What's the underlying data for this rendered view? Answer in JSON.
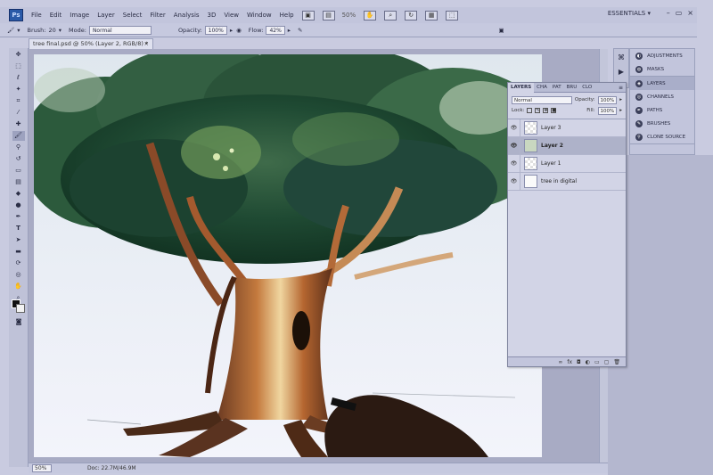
{
  "app": {
    "logo": "Ps",
    "menu": [
      "File",
      "Edit",
      "Image",
      "Layer",
      "Select",
      "Filter",
      "Analysis",
      "3D",
      "View",
      "Window",
      "Help"
    ],
    "zoom": "50%",
    "workspace": "ESSENTIALS ▾",
    "window_controls": [
      "–",
      "▭",
      "×"
    ]
  },
  "options_bar": {
    "brush_label": "Brush:",
    "brush_size": "20",
    "mode_label": "Mode:",
    "mode_value": "Normal",
    "opacity_label": "Opacity:",
    "opacity_value": "100%",
    "flow_label": "Flow:",
    "flow_value": "42%"
  },
  "document": {
    "tab_title": "tree final.psd @ 50% (Layer 2, RGB/8) *",
    "tab_close": "×",
    "status_zoom": "50%",
    "status_doc": "Doc: 22.7M/46.9M"
  },
  "right_panels": {
    "group1": [
      {
        "icon": "adjustments-icon",
        "label": "ADJUSTMENTS"
      },
      {
        "icon": "masks-icon",
        "label": "MASKS"
      }
    ],
    "group2": [
      {
        "icon": "layers-icon",
        "label": "LAYERS",
        "active": true
      },
      {
        "icon": "channels-icon",
        "label": "CHANNELS"
      },
      {
        "icon": "paths-icon",
        "label": "PATHS"
      },
      {
        "icon": "brushes-icon",
        "label": "BRUSHES"
      },
      {
        "icon": "clone-source-icon",
        "label": "CLONE SOURCE"
      }
    ]
  },
  "layers_panel": {
    "tabs": [
      "LAYERS",
      "CHA",
      "PAT",
      "BRU",
      "CLO"
    ],
    "menu_glyph": "≡",
    "blend_mode": "Normal",
    "opacity_label": "Opacity:",
    "opacity_value": "100%",
    "lock_label": "Lock:",
    "fill_label": "Fill:",
    "fill_value": "100%",
    "layers": [
      {
        "name": "Layer 3",
        "thumb": "transparent",
        "selected": false
      },
      {
        "name": "Layer 2",
        "thumb": "tree",
        "selected": true
      },
      {
        "name": "Layer 1",
        "thumb": "transparent",
        "selected": false
      },
      {
        "name": "tree in digital",
        "thumb": "white",
        "selected": false
      }
    ],
    "bottom_icons": [
      "link-icon",
      "fx-icon",
      "mask-icon",
      "adjustment-icon",
      "group-icon",
      "new-layer-icon",
      "trash-icon"
    ]
  }
}
